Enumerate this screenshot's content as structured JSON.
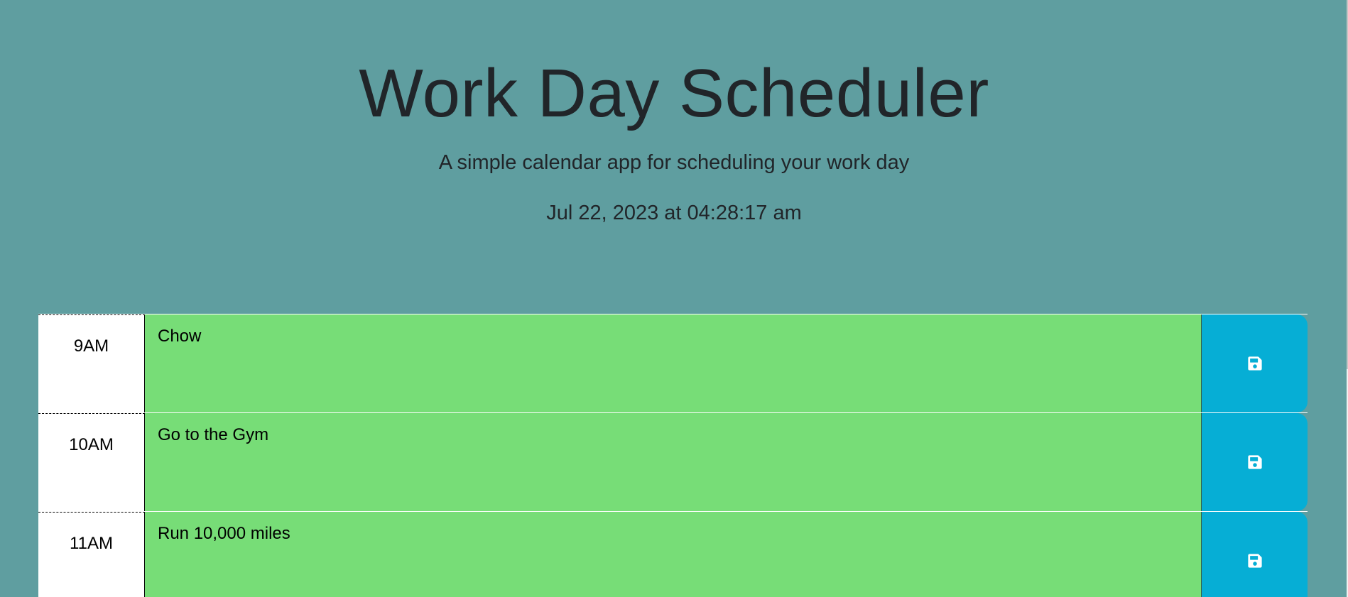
{
  "header": {
    "title": "Work Day Scheduler",
    "lead": "A simple calendar app for scheduling your work day",
    "current_day": "Jul 22, 2023 at 04:28:17 am"
  },
  "timeblocks": [
    {
      "hour": "9AM",
      "description": "Chow",
      "save_icon": "save-icon"
    },
    {
      "hour": "10AM",
      "description": "Go to the Gym",
      "save_icon": "save-icon"
    },
    {
      "hour": "11AM",
      "description": "Run 10,000 miles",
      "save_icon": "save-icon"
    }
  ],
  "colors": {
    "background": "#5f9ea0",
    "future": "#77dd77",
    "save_button": "#06aed5",
    "hour_bg": "#ffffff"
  }
}
